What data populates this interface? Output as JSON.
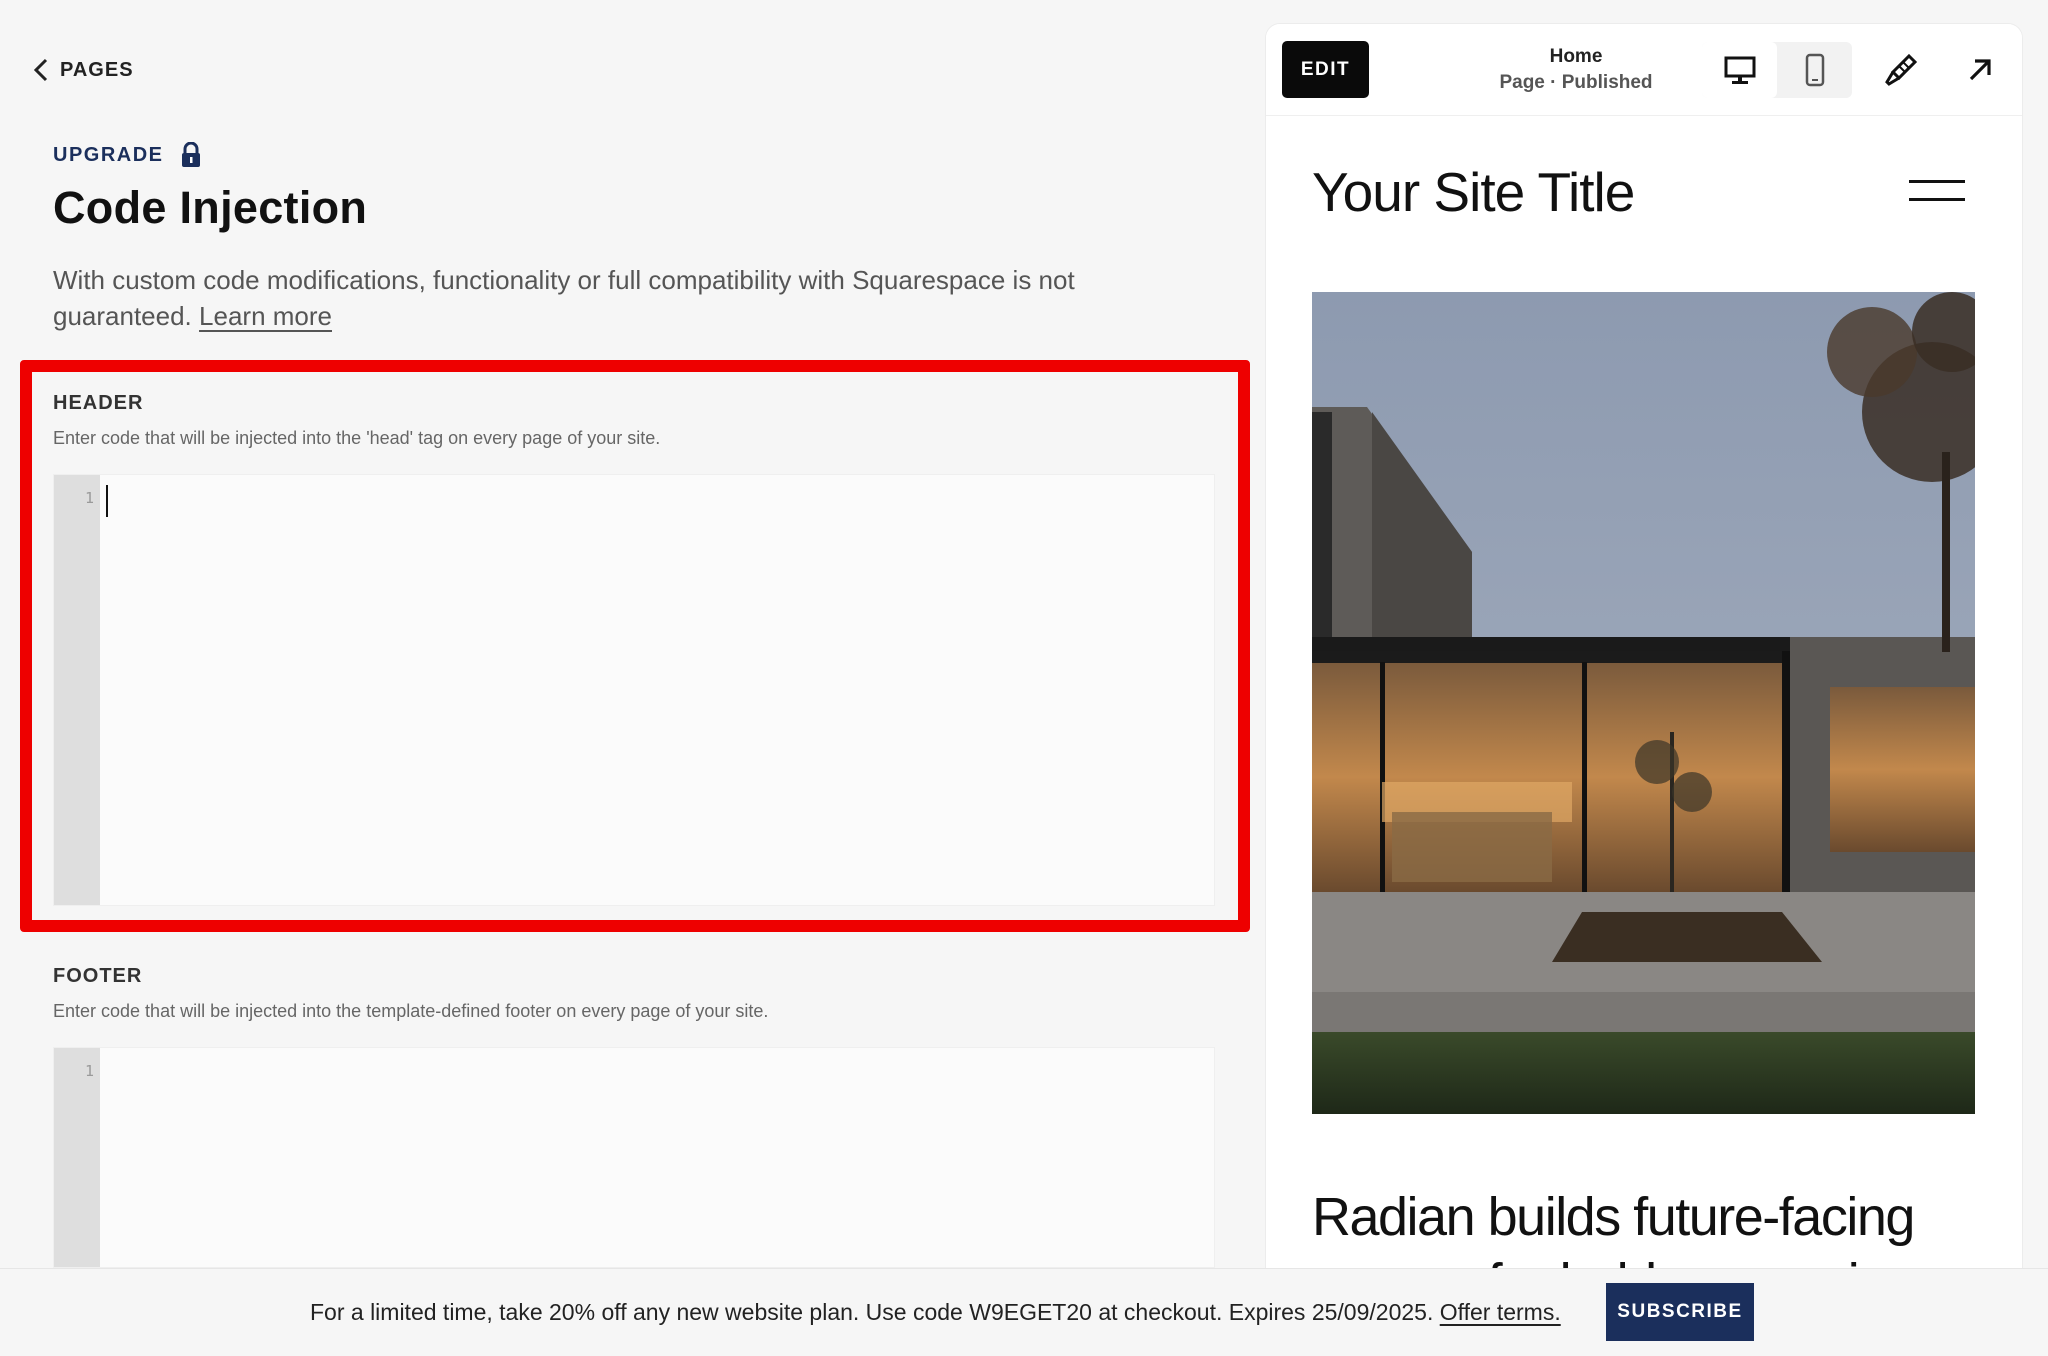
{
  "nav": {
    "back_label": "PAGES"
  },
  "settings": {
    "upgrade_label": "UPGRADE",
    "title": "Code Injection",
    "description": "With custom code modifications, functionality or full compatibility with Squarespace is not guaranteed.",
    "learn_more": "Learn more"
  },
  "header_section": {
    "label": "HEADER",
    "help": "Enter code that will be injected into the 'head' tag on every page of your site.",
    "line_number": "1",
    "value": ""
  },
  "footer_section": {
    "label": "FOOTER",
    "help": "Enter code that will be injected into the template-defined footer on every page of your site.",
    "line_number": "1",
    "value": ""
  },
  "preview": {
    "edit_label": "EDIT",
    "page_name": "Home",
    "page_status": "Page · Published",
    "site_title": "Your Site Title",
    "headline_line1": "Radian builds future-facing",
    "headline_line2": "spaces for bold expression",
    "icons": [
      "desktop-icon",
      "mobile-icon",
      "brush-icon",
      "external-link-icon",
      "menu-icon"
    ]
  },
  "promo": {
    "text": "For a limited time, take 20% off any new website plan. Use code W9EGET20 at checkout. Expires 25/09/2025.",
    "offer_link": "Offer terms.",
    "subscribe_label": "SUBSCRIBE"
  },
  "colors": {
    "accent": "#1b2f5c",
    "highlight": "#ee0000",
    "edit_button": "#0a0a0a"
  }
}
